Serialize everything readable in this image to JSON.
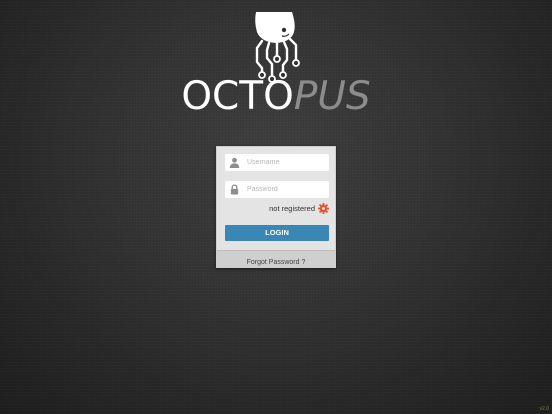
{
  "app": {
    "logo_text_primary": "OCTO",
    "logo_text_secondary": "PUS"
  },
  "login": {
    "username_placeholder": "Username",
    "password_placeholder": "Password",
    "registration_status": "not registered",
    "login_label": "LOGIN",
    "forgot_password_label": "Forgot Password ?"
  },
  "footer": {
    "version": "v2.0"
  },
  "icons": {
    "mascot": "octopus-mascot-icon",
    "username": "user-icon",
    "password": "lock-icon",
    "settings": "gear-icon"
  },
  "colors": {
    "background": "#333333",
    "logo_primary": "#ffffff",
    "logo_secondary": "#8c8c8c",
    "card": "#e4e4e4",
    "login_button": "#3a86b4",
    "gear": "#e2502c"
  }
}
